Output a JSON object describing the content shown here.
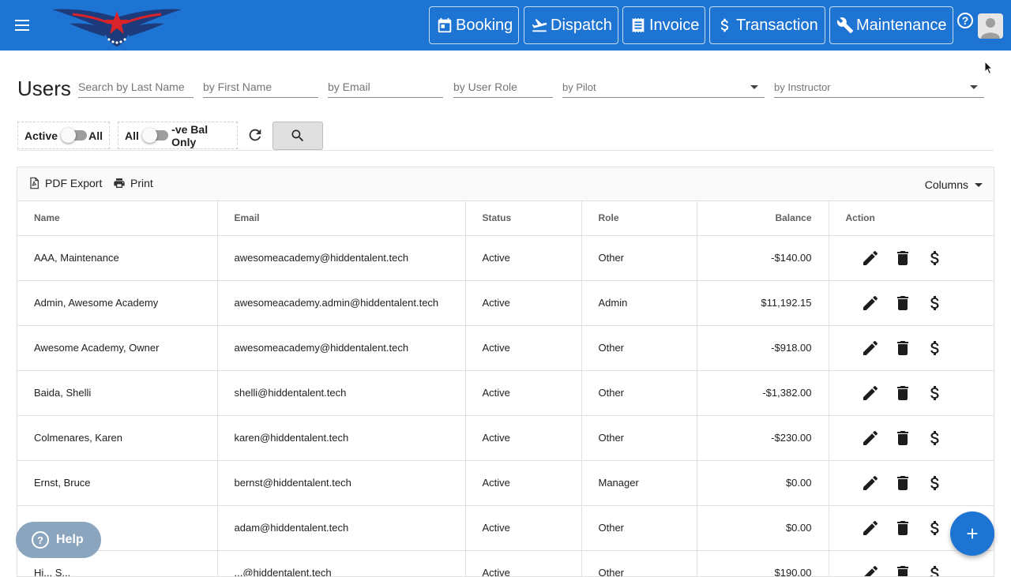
{
  "nav": {
    "buttons": [
      {
        "label": "Booking",
        "icon": "calendar-icon"
      },
      {
        "label": "Dispatch",
        "icon": "plane-takeoff-icon"
      },
      {
        "label": "Invoice",
        "icon": "receipt-icon"
      },
      {
        "label": "Transaction",
        "icon": "dollar-icon"
      },
      {
        "label": "Maintenance",
        "icon": "wrench-icon"
      }
    ],
    "help_icon": "?"
  },
  "filters": {
    "title": "Users",
    "last_name_placeholder": "Search by Last Name",
    "first_name_placeholder": "by First Name",
    "email_placeholder": "by Email",
    "role_placeholder": "by User Role",
    "pilot_select": "by Pilot",
    "instructor_select": "by Instructor",
    "active_toggle": {
      "left": "Active",
      "right": "All"
    },
    "balance_toggle": {
      "left": "All",
      "right": "-ve Bal Only"
    }
  },
  "grid": {
    "pdf_export": "PDF Export",
    "print": "Print",
    "columns": "Columns",
    "headers": [
      "Name",
      "Email",
      "Status",
      "Role",
      "Balance",
      "Action"
    ],
    "rows": [
      [
        "AAA, Maintenance",
        "awesomeacademy@hiddentalent.tech",
        "Active",
        "Other",
        "-$140.00"
      ],
      [
        "Admin, Awesome Academy",
        "awesomeacademy.admin@hiddentalent.tech",
        "Active",
        "Admin",
        "$11,192.15"
      ],
      [
        "Awesome Academy, Owner",
        "awesomeacademy@hiddentalent.tech",
        "Active",
        "Other",
        "-$918.00"
      ],
      [
        "Baida, Shelli",
        "shelli@hiddentalent.tech",
        "Active",
        "Other",
        "-$1,382.00"
      ],
      [
        "Colmenares, Karen",
        "karen@hiddentalent.tech",
        "Active",
        "Other",
        "-$230.00"
      ],
      [
        "Ernst, Bruce",
        "bernst@hiddentalent.tech",
        "Active",
        "Manager",
        "$0.00"
      ],
      [
        "",
        "adam@hiddentalent.tech",
        "Active",
        "Other",
        "$0.00"
      ],
      [
        "Hi... S...",
        "...@hiddentalent.tech",
        "Active",
        "Other",
        "$190.00"
      ]
    ],
    "action_icons": [
      "edit-icon",
      "delete-icon",
      "dollar-icon"
    ]
  },
  "help_widget": {
    "label": "Help"
  },
  "colors": {
    "primary": "#1e74d2",
    "help": "#8aa5bd",
    "logo_red": "#d8232a",
    "logo_navy": "#1d3a7a"
  }
}
